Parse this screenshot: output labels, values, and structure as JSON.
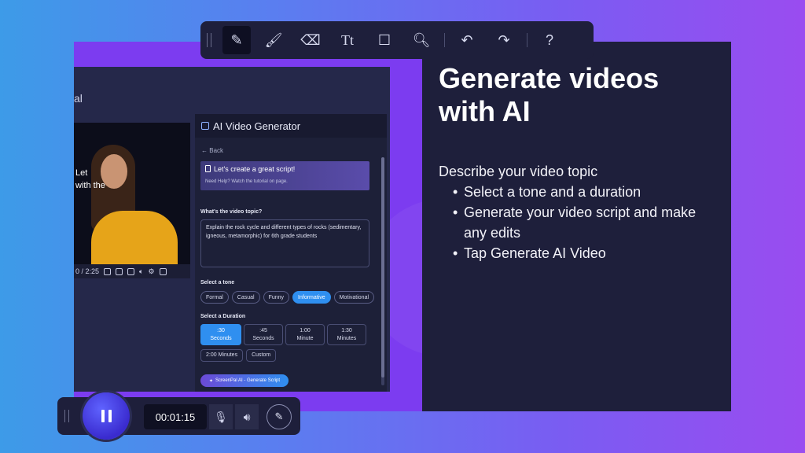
{
  "app_window": {
    "header_partial": "al",
    "video": {
      "caption_line1": "Let",
      "caption_line2": "with the",
      "time": "0 / 2:25"
    },
    "side_panel": {
      "title": "AI Video Generator",
      "back": "Back",
      "banner_title": "Let's create a great script!",
      "banner_help": "Need Help? Watch the tutorial on page.",
      "topic_label": "What's the video topic?",
      "topic_value": "Explain the rock cycle and different types of rocks (sedimentary, igneous, metamorphic) for 6th grade students",
      "tone_label": "Select a tone",
      "tones": [
        "Formal",
        "Casual",
        "Funny",
        "Informative",
        "Motivational"
      ],
      "tone_selected": "Informative",
      "duration_label": "Select a Duration",
      "durations": [
        {
          "top": ":30",
          "bottom": "Seconds"
        },
        {
          "top": ":45",
          "bottom": "Seconds"
        },
        {
          "top": "1:00",
          "bottom": "Minute"
        },
        {
          "top": "1:30",
          "bottom": "Minutes"
        }
      ],
      "duration_selected": ":30",
      "durations_row2": [
        "2:00 Minutes",
        "Custom"
      ],
      "generate_button": "ScreenPal AI - Generate Script"
    }
  },
  "info_panel": {
    "heading_line1": "Generate videos",
    "heading_line2": "with AI",
    "intro": "Describe your video topic",
    "bullets": [
      "Select a tone and a duration",
      "Generate your video script and make any edits",
      "Tap Generate AI Video"
    ]
  },
  "toolbar": {
    "tools": [
      "pen-icon",
      "highlighter-icon",
      "eraser-icon",
      "text-icon",
      "rectangle-icon",
      "zoom-icon",
      "undo-icon",
      "redo-icon",
      "help-icon"
    ],
    "text_tool_label": "Tt",
    "help_label": "?"
  },
  "recorder": {
    "timer": "00:01:15"
  },
  "colors": {
    "accent_blue": "#2f8ff0",
    "panel_dark": "#1e1f3b",
    "purple": "#7c3cf0"
  }
}
